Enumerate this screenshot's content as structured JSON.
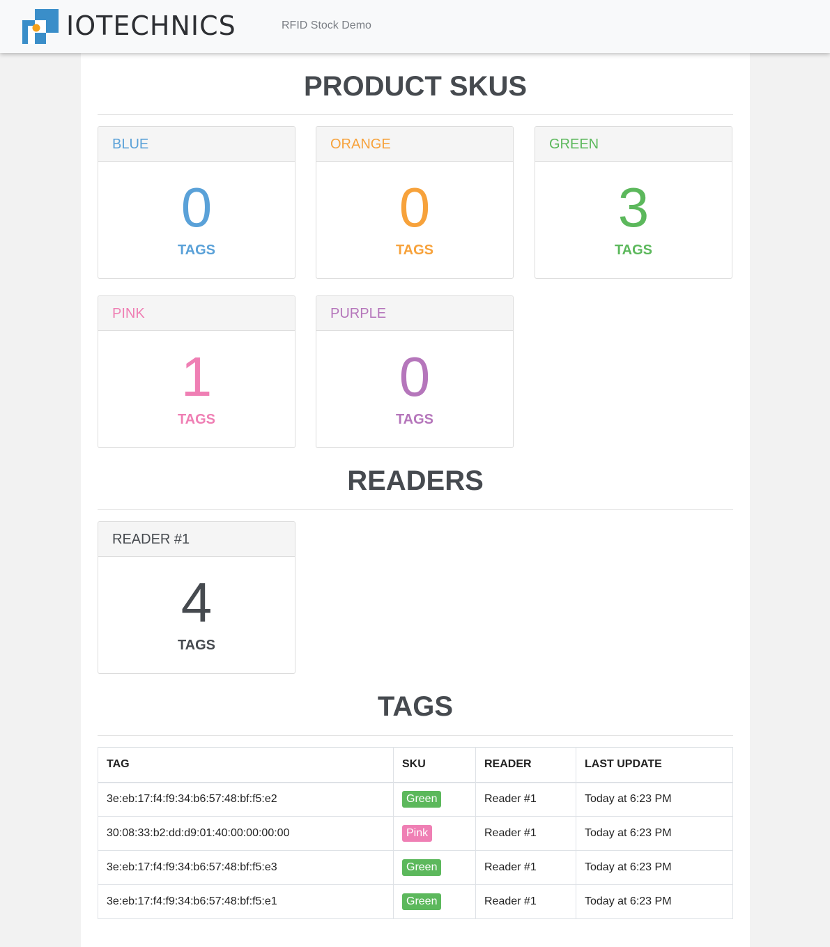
{
  "colors": {
    "blue": "#5aa1d8",
    "orange": "#f7a23b",
    "green": "#5cb85c",
    "pink": "#ef7fb4",
    "purple": "#b576bb",
    "dark": "#464a4f",
    "logo_blue": "#3a8ec9",
    "logo_orange": "#f5a01a"
  },
  "header": {
    "brand": "IOTECHNICS",
    "subtitle": "RFID Stock Demo"
  },
  "sections": {
    "skus_title": "PRODUCT SKUS",
    "readers_title": "READERS",
    "tags_title": "TAGS"
  },
  "skus": [
    {
      "name": "BLUE",
      "count": "0",
      "unit": "TAGS",
      "color": "#5aa1d8"
    },
    {
      "name": "ORANGE",
      "count": "0",
      "unit": "TAGS",
      "color": "#f7a23b"
    },
    {
      "name": "GREEN",
      "count": "3",
      "unit": "TAGS",
      "color": "#5cb85c"
    },
    {
      "name": "PINK",
      "count": "1",
      "unit": "TAGS",
      "color": "#ef7fb4"
    },
    {
      "name": "PURPLE",
      "count": "0",
      "unit": "TAGS",
      "color": "#b576bb"
    }
  ],
  "readers": [
    {
      "name": "READER #1",
      "count": "4",
      "unit": "TAGS"
    }
  ],
  "tags_table": {
    "headers": [
      "TAG",
      "SKU",
      "READER",
      "LAST UPDATE"
    ],
    "rows": [
      {
        "tag": "3e:eb:17:f4:f9:34:b6:57:48:bf:f5:e2",
        "sku": "Green",
        "sku_color": "#5cb85c",
        "reader": "Reader #1",
        "updated": "Today at 6:23 PM"
      },
      {
        "tag": "30:08:33:b2:dd:d9:01:40:00:00:00:00",
        "sku": "Pink",
        "sku_color": "#ef7fb4",
        "reader": "Reader #1",
        "updated": "Today at 6:23 PM"
      },
      {
        "tag": "3e:eb:17:f4:f9:34:b6:57:48:bf:f5:e3",
        "sku": "Green",
        "sku_color": "#5cb85c",
        "reader": "Reader #1",
        "updated": "Today at 6:23 PM"
      },
      {
        "tag": "3e:eb:17:f4:f9:34:b6:57:48:bf:f5:e1",
        "sku": "Green",
        "sku_color": "#5cb85c",
        "reader": "Reader #1",
        "updated": "Today at 6:23 PM"
      }
    ]
  }
}
